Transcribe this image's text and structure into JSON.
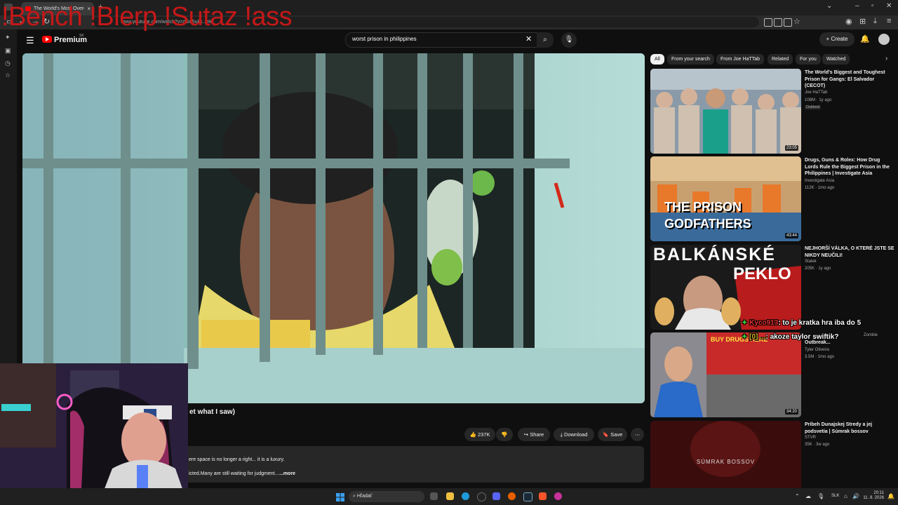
{
  "browser": {
    "tab_title": "The World's Most Overcr...",
    "tab_close": "×",
    "new_tab": "+",
    "url": "www.youtube.com/watch?v=qGu5ukk...ek",
    "overlay_text": "!Bench !Blerp !Sutaz !ass"
  },
  "header": {
    "brand": "Premium",
    "country": "SK",
    "search_value": "worst prison in philippines",
    "create_label": "Create"
  },
  "video": {
    "title": "et what I saw)",
    "like_count": "237K",
    "share_label": "Share",
    "download_label": "Download",
    "save_label": "Save",
    "desc_line1": "ere space is no longer a right... it is a luxury.",
    "desc_line2": "icted.Many are still waiting for judgment...",
    "desc_more": "...more"
  },
  "chips": [
    "All",
    "From your search",
    "From Joe HaTTab",
    "Related",
    "For you",
    "Watched"
  ],
  "recommendations": [
    {
      "title": "The World's Biggest and Toughest Prison for Gangs: El Salvador (CECOT)",
      "channel": "Joe HaTTab",
      "meta": "108M · 1y ago",
      "badge": "Dubbed",
      "duration": "23:05"
    },
    {
      "title": "Drugs, Guns & Rolex: How Drug Lords Rule the Biggest Prison in the Philippines | Investigate Asia",
      "channel": "Investigate Asia",
      "meta": "112K · 1mo ago",
      "duration": "43:44",
      "thumb_text1": "THE PRISON",
      "thumb_text2": "GODFATHERS"
    },
    {
      "title": "NEJHORŠÍ VÁLKA, O KTERÉ JSTE SE NIKDY NEUČILI!",
      "channel": "Stalek",
      "meta": "205K · 1y ago",
      "thumb_text1": "BALKÁNSKÉ",
      "thumb_text2": "PEKLO"
    },
    {
      "title": "Outbreak...",
      "channel": "Tyler Oliveira",
      "meta": "3.5M · 1mo ago",
      "duration": "34:20",
      "thumb_text1": "BUY DRUGS HERE",
      "extra": "Zombie"
    },
    {
      "title": "Príbeh Dunajskej Stredy a jej podsvetia | Súmrak bossov",
      "channel": "STVR",
      "meta": "35K · 3w ago",
      "thumb_text1": "SÚMRAK BOSSOV"
    }
  ],
  "chat": [
    {
      "user": "Kyco913",
      "text": ": to je kratka hra iba do 5"
    },
    {
      "user": "[0] ...",
      "text": ": akoze taylor swiftik?"
    }
  ],
  "taskbar": {
    "search_placeholder": "Hľadať",
    "lang": "SLK",
    "time": "20:11",
    "date": "11. 8. 2026"
  },
  "colors": {
    "youtube_red": "#ff0000",
    "overlay_red": "#c41818",
    "chat_user": "#e03030"
  }
}
